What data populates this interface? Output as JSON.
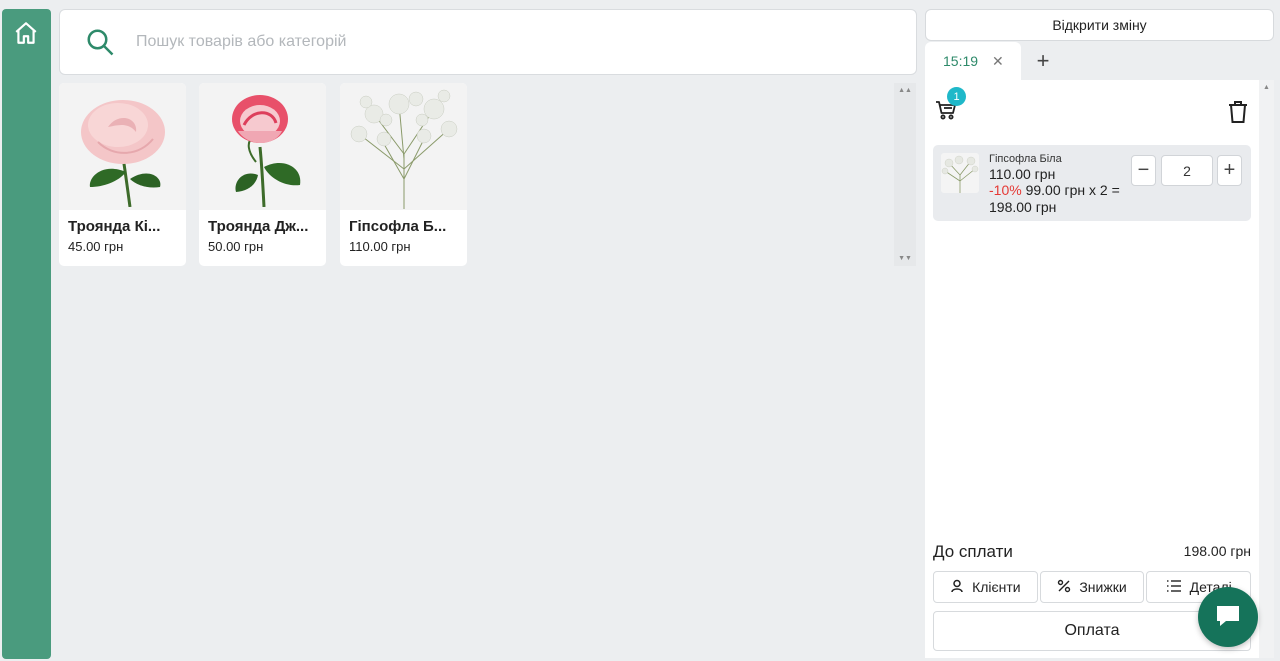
{
  "search": {
    "placeholder": "Пошук товарів або категорій"
  },
  "products": [
    {
      "name": "Троянда Кі...",
      "price": "45.00 грн"
    },
    {
      "name": "Троянда Дж...",
      "price": "50.00 грн"
    },
    {
      "name": "Гіпсофла Б...",
      "price": "110.00 грн"
    }
  ],
  "right_panel": {
    "open_shift_label": "Відкрити зміну",
    "tab_time": "15:19",
    "cart_count": "1",
    "line_item": {
      "name": "Гіпсофла Біла",
      "price": "110.00 грн",
      "discount": "-10%",
      "discount_rest": " 99.00 грн x 2 = 198.00 грн",
      "quantity": "2"
    },
    "total_label": "До сплати",
    "total_value": "198.00 грн",
    "actions": {
      "clients": "Клієнти",
      "discounts": "Знижки",
      "details": "Деталі"
    },
    "pay_label": "Оплата"
  },
  "colors": {
    "sidebar": "#4a9b7e",
    "accent": "#2e8a6a",
    "badge": "#1fb8c9",
    "discount": "#e53935",
    "chat": "#15735a"
  }
}
